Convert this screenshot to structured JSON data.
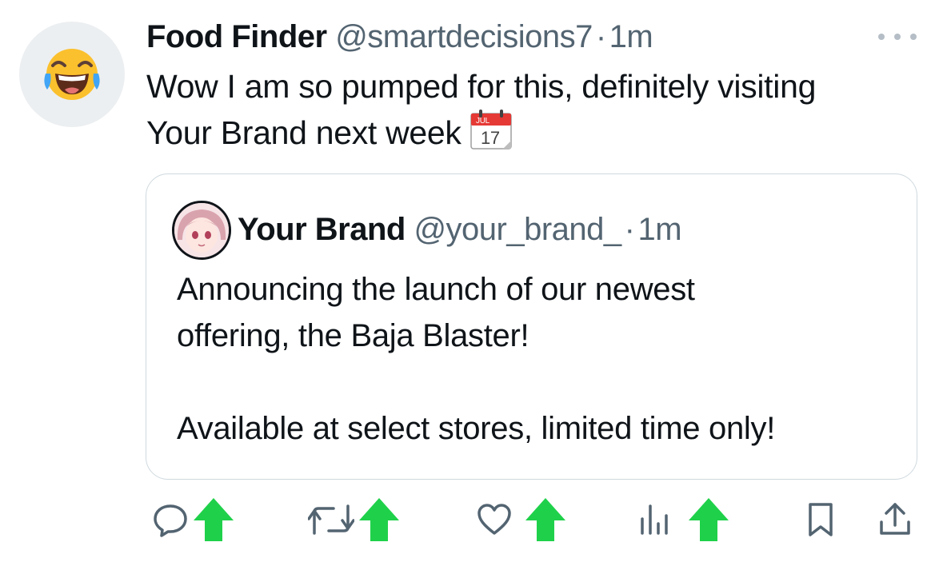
{
  "tweet": {
    "author_name": "Food Finder",
    "handle": "@smartdecisions7",
    "separator": "·",
    "time": "1m",
    "text_line1": "Wow I am so pumped for this, definitely visiting",
    "text_line2": "Your Brand next week",
    "avatar_icon": "laughing-tears-emoji-icon",
    "emoji": {
      "icon": "calendar-icon",
      "month": "JUL",
      "day": "17"
    }
  },
  "quote": {
    "author_name": "Your Brand",
    "handle": "@your_brand_",
    "separator": "·",
    "time": "1m",
    "line1": "Announcing the launch of our newest",
    "line2": "offering, the Baja Blaster!",
    "line3": "Available at select stores, limited time only!",
    "avatar_icon": "anime-avatar-icon"
  },
  "actions": [
    {
      "name": "reply",
      "icon": "reply-icon",
      "badge_icon": "green-up-arrow-icon"
    },
    {
      "name": "repost",
      "icon": "repost-icon",
      "badge_icon": "green-up-arrow-icon"
    },
    {
      "name": "like",
      "icon": "heart-icon",
      "badge_icon": "green-up-arrow-icon"
    },
    {
      "name": "views",
      "icon": "views-icon",
      "badge_icon": "green-up-arrow-icon"
    },
    {
      "name": "bookmark",
      "icon": "bookmark-icon"
    },
    {
      "name": "share",
      "icon": "share-icon"
    }
  ],
  "colors": {
    "text": "#0f1419",
    "muted": "#536471",
    "border": "#cfd9de",
    "badge_green": "#1fd14a"
  }
}
